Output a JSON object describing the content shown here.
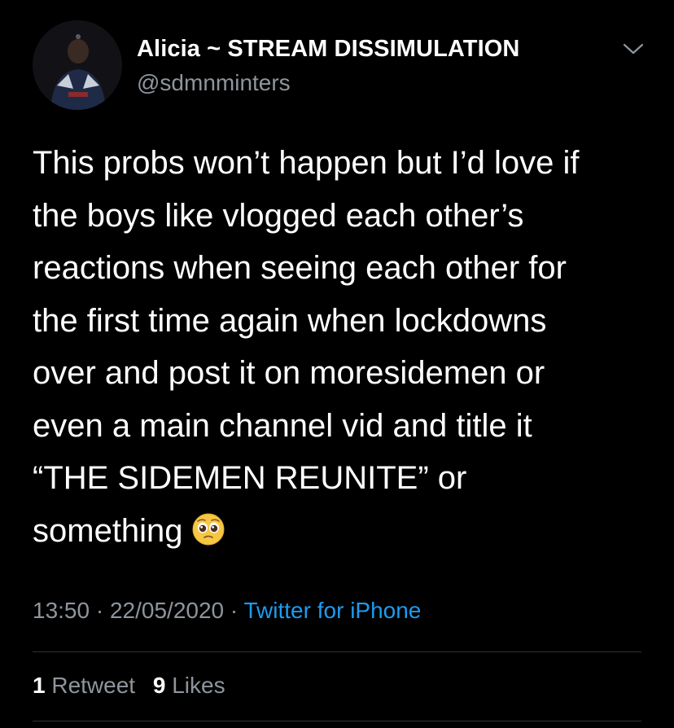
{
  "author": {
    "display_name": "Alicia ~ STREAM DISSIMULATION",
    "handle": "@sdmnminters",
    "avatar_icon": "profile-photo-avatar"
  },
  "menu": {
    "icon": "chevron-down-icon"
  },
  "tweet": {
    "text_lines": [
      "This probs won’t happen but I’d love if",
      "the boys like vlogged each other’s",
      "reactions when seeing each other for",
      "the first time again when lockdowns",
      "over and post it on moresidemen or",
      "even a main channel vid and title it",
      "“THE SIDEMEN REUNITE” or",
      "something"
    ],
    "emoji": "pleading-face-emoji"
  },
  "meta": {
    "time": "13:50",
    "separator": "·",
    "date": "22/05/2020",
    "source": "Twitter for iPhone"
  },
  "stats": {
    "retweets_count": "1",
    "retweets_label": "Retweet",
    "likes_count": "9",
    "likes_label": "Likes"
  },
  "colors": {
    "background": "#000000",
    "text_primary": "#ffffff",
    "text_secondary": "#8e959c",
    "accent": "#1d9bf0",
    "divider": "#2f3336"
  }
}
